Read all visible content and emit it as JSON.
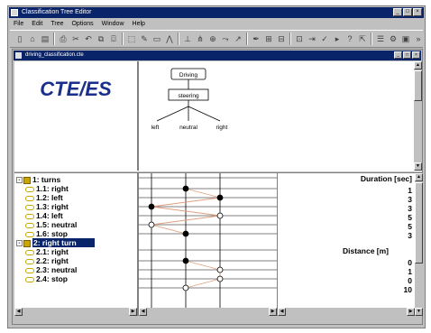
{
  "window": {
    "title": "Classification Tree Editor"
  },
  "menu": [
    "File",
    "Edit",
    "Tree",
    "Options",
    "Window",
    "Help"
  ],
  "document": {
    "title": "driving_classification.cte"
  },
  "logo": {
    "text": "CTE/ES"
  },
  "diagram": {
    "root": "Driving",
    "classification": "steering",
    "classes": [
      "left",
      "neutral",
      "right"
    ]
  },
  "tree": {
    "items": [
      {
        "label": "1: turns",
        "kind": "class",
        "expander": "-"
      },
      {
        "label": "1.1: right",
        "kind": "leaf"
      },
      {
        "label": "1.2: left",
        "kind": "leaf"
      },
      {
        "label": "1.3: right",
        "kind": "leaf"
      },
      {
        "label": "1.4: left",
        "kind": "leaf"
      },
      {
        "label": "1.5: neutral",
        "kind": "leaf"
      },
      {
        "label": "1.6: stop",
        "kind": "leaf"
      },
      {
        "label": "2: right turn",
        "kind": "class",
        "expander": "-",
        "selected": true
      },
      {
        "label": "2.1: right",
        "kind": "leaf"
      },
      {
        "label": "2.2: right",
        "kind": "leaf"
      },
      {
        "label": "2.3: neutral",
        "kind": "leaf"
      },
      {
        "label": "2.4: stop",
        "kind": "leaf"
      }
    ]
  },
  "values": {
    "duration_header": "Duration [sec]",
    "duration": [
      "1",
      "3",
      "3",
      "5",
      "5",
      "3"
    ],
    "distance_header": "Distance [m]",
    "distance": [
      "0",
      "1",
      "0",
      "10"
    ]
  },
  "matrix": {
    "rows_group1": [
      {
        "marker": "filled",
        "col": 1
      },
      {
        "marker": "filled",
        "col": 2
      },
      {
        "marker": "filled",
        "col": 0
      },
      {
        "marker": "hollow",
        "col": 2
      },
      {
        "marker": "hollow",
        "col": 0
      },
      {
        "marker": "filled",
        "col": 1
      }
    ],
    "rows_group2": [
      {
        "marker": "filled",
        "col": 1
      },
      {
        "marker": "hollow",
        "col": 2
      },
      {
        "marker": "hollow",
        "col": 2
      },
      {
        "marker": "hollow",
        "col": 1
      }
    ]
  },
  "colors": {
    "titlebar": "#0a246a",
    "logo": "#1a2e8c",
    "path_line": "#e0a080",
    "tree_icon": "#c8a800"
  }
}
